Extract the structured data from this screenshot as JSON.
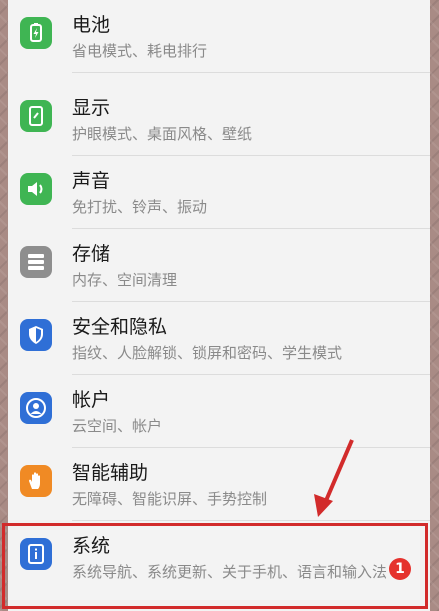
{
  "settings": {
    "items": [
      {
        "title": "电池",
        "subtitle": "省电模式、耗电排行",
        "icon": "battery-icon",
        "color": "#3fb553"
      },
      {
        "title": "显示",
        "subtitle": "护眼模式、桌面风格、壁纸",
        "icon": "display-icon",
        "color": "#3fb553"
      },
      {
        "title": "声音",
        "subtitle": "免打扰、铃声、振动",
        "icon": "sound-icon",
        "color": "#3fb553"
      },
      {
        "title": "存储",
        "subtitle": "内存、空间清理",
        "icon": "storage-icon",
        "color": "#8e8e8e"
      },
      {
        "title": "安全和隐私",
        "subtitle": "指纹、人脸解锁、锁屏和密码、学生模式",
        "icon": "security-shield-icon",
        "color": "#2f6fd6"
      },
      {
        "title": "帐户",
        "subtitle": "云空间、帐户",
        "icon": "account-icon",
        "color": "#2f6fd6"
      },
      {
        "title": "智能辅助",
        "subtitle": "无障碍、智能识屏、手势控制",
        "icon": "hand-icon",
        "color": "#f08a24"
      },
      {
        "title": "系统",
        "subtitle": "系统导航、系统更新、关于手机、语言和输入法",
        "icon": "system-info-icon",
        "color": "#2f6fd6",
        "badge": "1"
      }
    ]
  },
  "annotation": {
    "highlight_color": "#d22b2b"
  }
}
